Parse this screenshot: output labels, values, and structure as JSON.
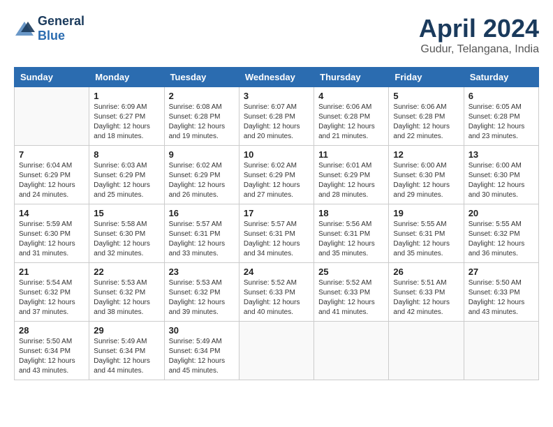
{
  "header": {
    "logo_line1": "General",
    "logo_line2": "Blue",
    "month_title": "April 2024",
    "location": "Gudur, Telangana, India"
  },
  "weekdays": [
    "Sunday",
    "Monday",
    "Tuesday",
    "Wednesday",
    "Thursday",
    "Friday",
    "Saturday"
  ],
  "weeks": [
    [
      {
        "day": "",
        "sunrise": "",
        "sunset": "",
        "daylight": ""
      },
      {
        "day": "1",
        "sunrise": "Sunrise: 6:09 AM",
        "sunset": "Sunset: 6:27 PM",
        "daylight": "Daylight: 12 hours and 18 minutes."
      },
      {
        "day": "2",
        "sunrise": "Sunrise: 6:08 AM",
        "sunset": "Sunset: 6:28 PM",
        "daylight": "Daylight: 12 hours and 19 minutes."
      },
      {
        "day": "3",
        "sunrise": "Sunrise: 6:07 AM",
        "sunset": "Sunset: 6:28 PM",
        "daylight": "Daylight: 12 hours and 20 minutes."
      },
      {
        "day": "4",
        "sunrise": "Sunrise: 6:06 AM",
        "sunset": "Sunset: 6:28 PM",
        "daylight": "Daylight: 12 hours and 21 minutes."
      },
      {
        "day": "5",
        "sunrise": "Sunrise: 6:06 AM",
        "sunset": "Sunset: 6:28 PM",
        "daylight": "Daylight: 12 hours and 22 minutes."
      },
      {
        "day": "6",
        "sunrise": "Sunrise: 6:05 AM",
        "sunset": "Sunset: 6:28 PM",
        "daylight": "Daylight: 12 hours and 23 minutes."
      }
    ],
    [
      {
        "day": "7",
        "sunrise": "Sunrise: 6:04 AM",
        "sunset": "Sunset: 6:29 PM",
        "daylight": "Daylight: 12 hours and 24 minutes."
      },
      {
        "day": "8",
        "sunrise": "Sunrise: 6:03 AM",
        "sunset": "Sunset: 6:29 PM",
        "daylight": "Daylight: 12 hours and 25 minutes."
      },
      {
        "day": "9",
        "sunrise": "Sunrise: 6:02 AM",
        "sunset": "Sunset: 6:29 PM",
        "daylight": "Daylight: 12 hours and 26 minutes."
      },
      {
        "day": "10",
        "sunrise": "Sunrise: 6:02 AM",
        "sunset": "Sunset: 6:29 PM",
        "daylight": "Daylight: 12 hours and 27 minutes."
      },
      {
        "day": "11",
        "sunrise": "Sunrise: 6:01 AM",
        "sunset": "Sunset: 6:29 PM",
        "daylight": "Daylight: 12 hours and 28 minutes."
      },
      {
        "day": "12",
        "sunrise": "Sunrise: 6:00 AM",
        "sunset": "Sunset: 6:30 PM",
        "daylight": "Daylight: 12 hours and 29 minutes."
      },
      {
        "day": "13",
        "sunrise": "Sunrise: 6:00 AM",
        "sunset": "Sunset: 6:30 PM",
        "daylight": "Daylight: 12 hours and 30 minutes."
      }
    ],
    [
      {
        "day": "14",
        "sunrise": "Sunrise: 5:59 AM",
        "sunset": "Sunset: 6:30 PM",
        "daylight": "Daylight: 12 hours and 31 minutes."
      },
      {
        "day": "15",
        "sunrise": "Sunrise: 5:58 AM",
        "sunset": "Sunset: 6:30 PM",
        "daylight": "Daylight: 12 hours and 32 minutes."
      },
      {
        "day": "16",
        "sunrise": "Sunrise: 5:57 AM",
        "sunset": "Sunset: 6:31 PM",
        "daylight": "Daylight: 12 hours and 33 minutes."
      },
      {
        "day": "17",
        "sunrise": "Sunrise: 5:57 AM",
        "sunset": "Sunset: 6:31 PM",
        "daylight": "Daylight: 12 hours and 34 minutes."
      },
      {
        "day": "18",
        "sunrise": "Sunrise: 5:56 AM",
        "sunset": "Sunset: 6:31 PM",
        "daylight": "Daylight: 12 hours and 35 minutes."
      },
      {
        "day": "19",
        "sunrise": "Sunrise: 5:55 AM",
        "sunset": "Sunset: 6:31 PM",
        "daylight": "Daylight: 12 hours and 35 minutes."
      },
      {
        "day": "20",
        "sunrise": "Sunrise: 5:55 AM",
        "sunset": "Sunset: 6:32 PM",
        "daylight": "Daylight: 12 hours and 36 minutes."
      }
    ],
    [
      {
        "day": "21",
        "sunrise": "Sunrise: 5:54 AM",
        "sunset": "Sunset: 6:32 PM",
        "daylight": "Daylight: 12 hours and 37 minutes."
      },
      {
        "day": "22",
        "sunrise": "Sunrise: 5:53 AM",
        "sunset": "Sunset: 6:32 PM",
        "daylight": "Daylight: 12 hours and 38 minutes."
      },
      {
        "day": "23",
        "sunrise": "Sunrise: 5:53 AM",
        "sunset": "Sunset: 6:32 PM",
        "daylight": "Daylight: 12 hours and 39 minutes."
      },
      {
        "day": "24",
        "sunrise": "Sunrise: 5:52 AM",
        "sunset": "Sunset: 6:33 PM",
        "daylight": "Daylight: 12 hours and 40 minutes."
      },
      {
        "day": "25",
        "sunrise": "Sunrise: 5:52 AM",
        "sunset": "Sunset: 6:33 PM",
        "daylight": "Daylight: 12 hours and 41 minutes."
      },
      {
        "day": "26",
        "sunrise": "Sunrise: 5:51 AM",
        "sunset": "Sunset: 6:33 PM",
        "daylight": "Daylight: 12 hours and 42 minutes."
      },
      {
        "day": "27",
        "sunrise": "Sunrise: 5:50 AM",
        "sunset": "Sunset: 6:33 PM",
        "daylight": "Daylight: 12 hours and 43 minutes."
      }
    ],
    [
      {
        "day": "28",
        "sunrise": "Sunrise: 5:50 AM",
        "sunset": "Sunset: 6:34 PM",
        "daylight": "Daylight: 12 hours and 43 minutes."
      },
      {
        "day": "29",
        "sunrise": "Sunrise: 5:49 AM",
        "sunset": "Sunset: 6:34 PM",
        "daylight": "Daylight: 12 hours and 44 minutes."
      },
      {
        "day": "30",
        "sunrise": "Sunrise: 5:49 AM",
        "sunset": "Sunset: 6:34 PM",
        "daylight": "Daylight: 12 hours and 45 minutes."
      },
      {
        "day": "",
        "sunrise": "",
        "sunset": "",
        "daylight": ""
      },
      {
        "day": "",
        "sunrise": "",
        "sunset": "",
        "daylight": ""
      },
      {
        "day": "",
        "sunrise": "",
        "sunset": "",
        "daylight": ""
      },
      {
        "day": "",
        "sunrise": "",
        "sunset": "",
        "daylight": ""
      }
    ]
  ]
}
